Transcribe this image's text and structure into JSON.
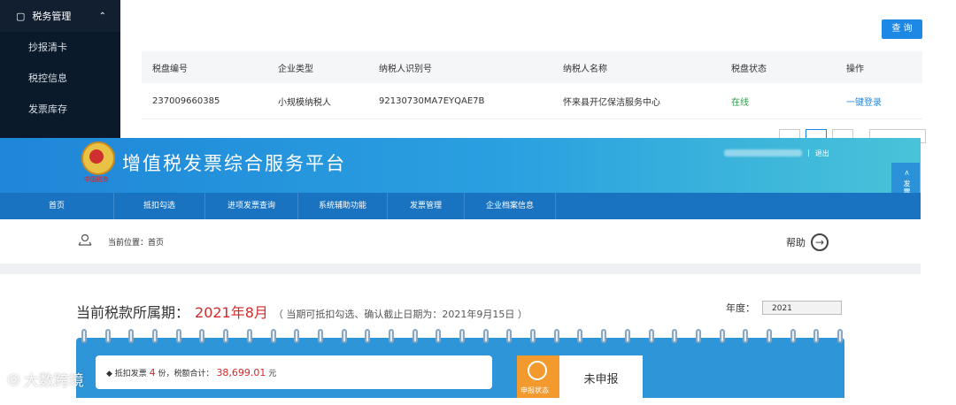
{
  "sidebar": {
    "header_label": "税务管理",
    "items": [
      {
        "label": "抄报清卡"
      },
      {
        "label": "税控信息"
      },
      {
        "label": "发票库存"
      }
    ]
  },
  "disk_panel": {
    "query_label": "查 询",
    "columns": [
      "税盘编号",
      "企业类型",
      "纳税人识别号",
      "纳税人名称",
      "税盘状态",
      "操作"
    ],
    "rows": [
      {
        "disk_no": "237009660385",
        "type": "小规模纳税人",
        "tax_id": "92130730MA7EYQAE7B",
        "name": "怀来县开亿保洁服务中心",
        "status": "在线",
        "action": "一键登录"
      }
    ]
  },
  "platform": {
    "emblem_motto": "中国税务",
    "title": "增值税发票综合服务平台",
    "logout": "退出",
    "user_separator": "|",
    "side_tab": "< 发票查验平台",
    "nav": [
      "首页",
      "抵扣勾选",
      "进项发票查询",
      "系统辅助功能",
      "发票管理",
      "企业档案信息"
    ],
    "breadcrumb": "当前位置：首页",
    "help": "帮助",
    "period_label": "当前税款所属期：",
    "period_value": "2021年8月",
    "period_note": "（ 当期可抵扣勾选、确认截止日期为：2021年9月15日 ）",
    "year_label": "年度：",
    "year_value": "2021",
    "deduct_prefix": "◆ 抵扣发票",
    "deduct_count": "4",
    "deduct_mid": "份，税额合计：",
    "deduct_amount": "38,699.01",
    "deduct_unit": "元",
    "declare_label": "申报状态",
    "declare_status": "未申报"
  },
  "watermark": "大数跨境",
  "colors": {
    "banner": "#1f86d8",
    "nav": "#1a73c0",
    "accent_red": "#d12a2a",
    "online_green": "#2e9b4a",
    "orange": "#f39a2e"
  }
}
